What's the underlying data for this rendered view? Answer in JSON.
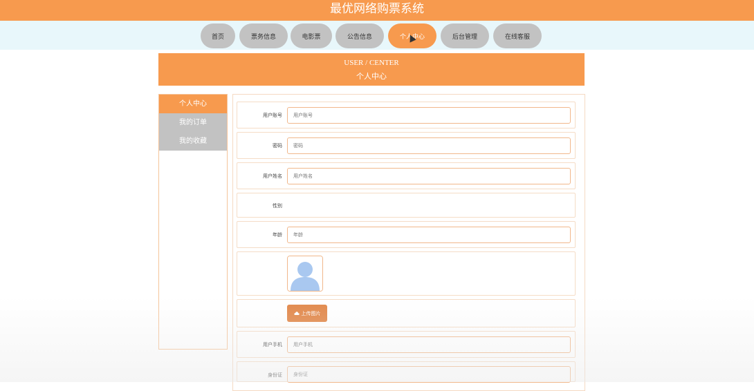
{
  "header": {
    "title": "最优网络购票系统"
  },
  "nav": {
    "items": [
      {
        "label": "首页"
      },
      {
        "label": "票务信息"
      },
      {
        "label": "电影票"
      },
      {
        "label": "公告信息"
      },
      {
        "label": "个人中心"
      },
      {
        "label": "后台管理"
      },
      {
        "label": "在线客服"
      }
    ],
    "active_index": 4
  },
  "banner": {
    "en": "USER / CENTER",
    "cn": "个人中心"
  },
  "sidebar": {
    "items": [
      {
        "label": "个人中心"
      },
      {
        "label": "我的订单"
      },
      {
        "label": "我的收藏"
      }
    ]
  },
  "form": {
    "account": {
      "label": "用户账号",
      "placeholder": "用户账号"
    },
    "password": {
      "label": "密码",
      "placeholder": "密码"
    },
    "name": {
      "label": "用户姓名",
      "placeholder": "用户姓名"
    },
    "gender": {
      "label": "性别"
    },
    "age": {
      "label": "年龄",
      "placeholder": "年龄"
    },
    "upload_button": "上传图片",
    "phone": {
      "label": "用户手机",
      "placeholder": "用户手机"
    },
    "id_card": {
      "label": "身份证",
      "placeholder": "身份证"
    }
  },
  "colors": {
    "accent": "#f79a4e",
    "nav_inactive": "#c2c2c2",
    "nav_band": "#e8f7fb"
  }
}
